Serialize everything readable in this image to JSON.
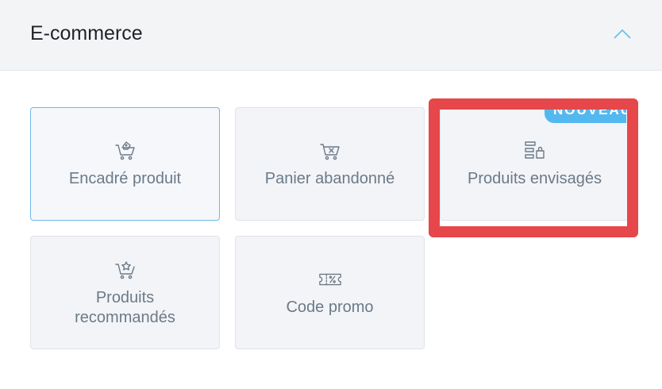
{
  "section": {
    "title": "E-commerce",
    "collapse_icon": "chevron-up-icon"
  },
  "cards": [
    {
      "label": "Encadré produit",
      "icon": "cart-tag-icon",
      "selected": true
    },
    {
      "label": "Panier abandonné",
      "icon": "cart-x-icon"
    },
    {
      "label": "Produits envisagés",
      "icon": "browse-products-icon",
      "badge": "NOUVEAU"
    },
    {
      "label": "Produits recommandés",
      "icon": "cart-star-icon"
    },
    {
      "label": "Code promo",
      "icon": "coupon-percent-icon"
    }
  ],
  "colors": {
    "accent": "#54b8f0",
    "highlight": "#e5474b",
    "card_bg": "#f3f4f7",
    "selected_border": "#6fb7e8",
    "label": "#6b7a88"
  }
}
